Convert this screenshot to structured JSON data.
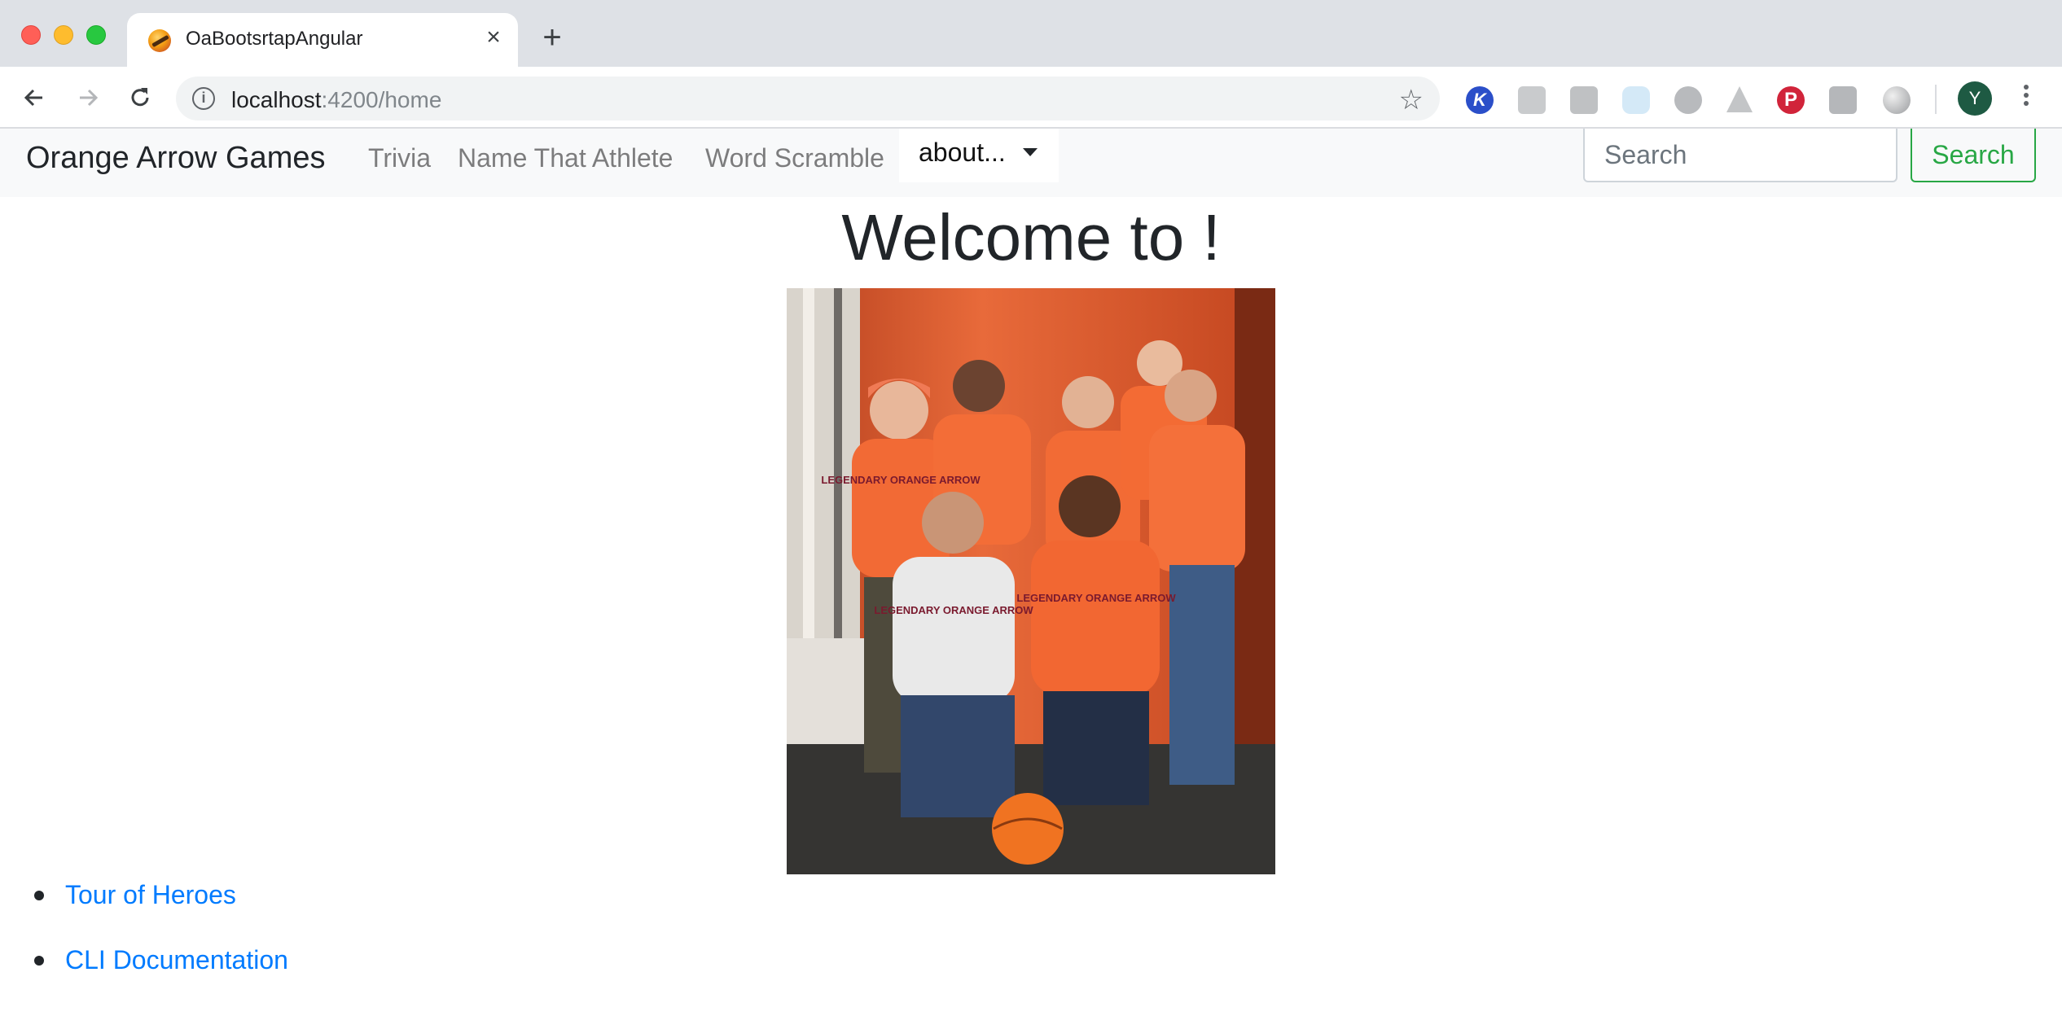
{
  "browser": {
    "tab_title": "OaBootsrtapAngular",
    "url_host": "localhost",
    "url_path": ":4200/home",
    "avatar_letter": "Y",
    "extensions": [
      "k-icon",
      "camera-icon",
      "h-icon",
      "cloud-icon",
      "parachute-icon",
      "cone-icon",
      "pinterest-icon",
      "acrobat-icon",
      "orb-icon"
    ]
  },
  "navbar": {
    "brand": "Orange Arrow Games",
    "links": [
      "Trivia",
      "Name That Athlete",
      "Word Scramble"
    ],
    "dropdown_label": "about...",
    "search_placeholder": "Search",
    "search_button": "Search"
  },
  "main": {
    "heading": "Welcome to !",
    "photo_text": "LEGENDARY ORANGE ARROW",
    "links": [
      {
        "label": "Tour of Heroes"
      },
      {
        "label": "CLI Documentation"
      }
    ]
  },
  "colors": {
    "brand_orange": "#f0612d",
    "link_blue": "#007bff",
    "search_green": "#28a745"
  }
}
